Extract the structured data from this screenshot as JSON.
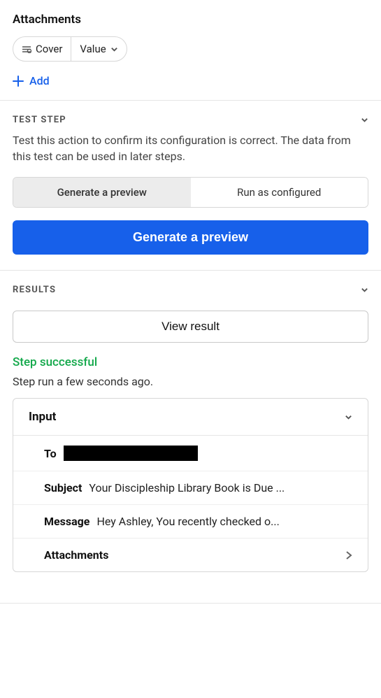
{
  "attachments": {
    "title": "Attachments",
    "cover_label": "Cover",
    "value_label": "Value",
    "add_label": "Add"
  },
  "test_step": {
    "header": "TEST STEP",
    "description": "Test this action to confirm its configuration is correct. The data from this test can be used in later steps.",
    "option_preview": "Generate a preview",
    "option_run": "Run as configured",
    "cta": "Generate a preview"
  },
  "results": {
    "header": "RESULTS",
    "view_button": "View result",
    "status": "Step successful",
    "timestamp": "Step run a few seconds ago.",
    "input_header": "Input",
    "rows": {
      "to_label": "To",
      "subject_label": "Subject",
      "subject_value": "Your Discipleship Library Book is Due ...",
      "message_label": "Message",
      "message_value": "Hey Ashley, You recently checked o...",
      "attachments_label": "Attachments"
    }
  }
}
